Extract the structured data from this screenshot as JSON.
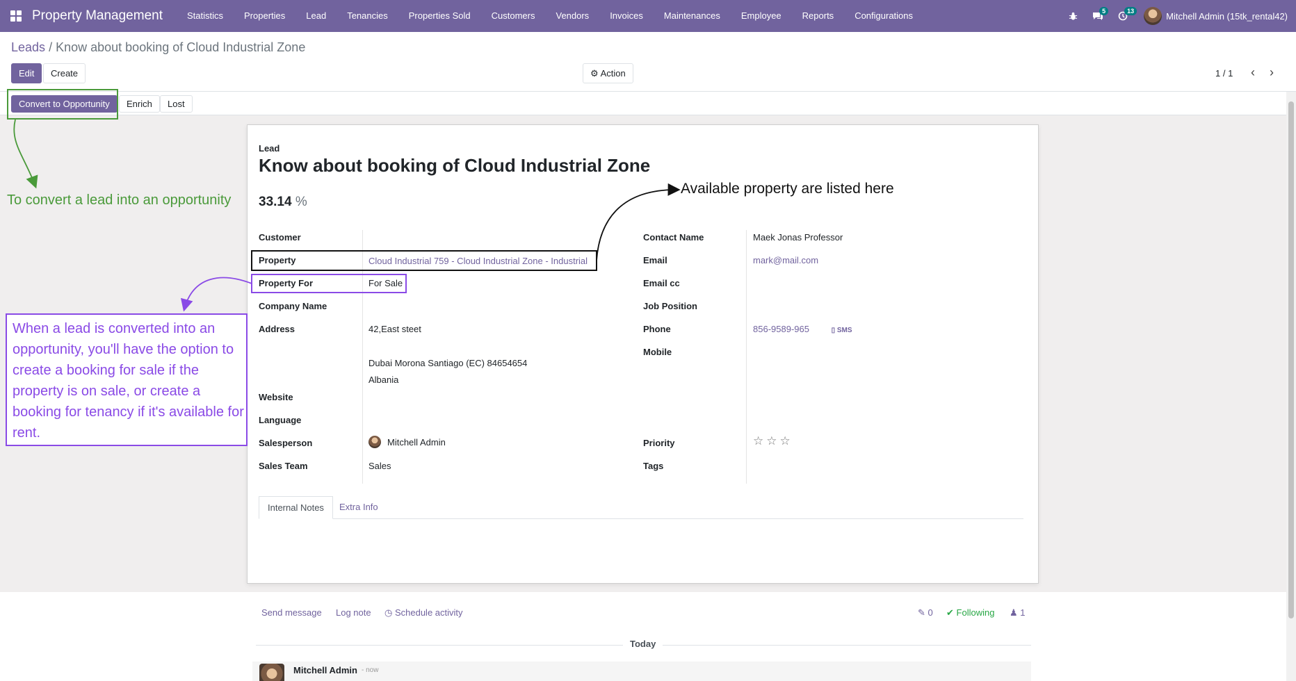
{
  "navbar": {
    "app_title": "Property Management",
    "menu": [
      "Statistics",
      "Properties",
      "Lead",
      "Tenancies",
      "Properties Sold",
      "Customers",
      "Vendors",
      "Invoices",
      "Maintenances",
      "Employee",
      "Reports",
      "Configurations"
    ],
    "messages_count": "5",
    "activities_count": "13",
    "user": "Mitchell Admin (15tk_rental42)"
  },
  "breadcrumb": {
    "parent": "Leads",
    "separator": "/",
    "current": "Know about booking of Cloud Industrial Zone"
  },
  "toolbar": {
    "edit": "Edit",
    "create": "Create",
    "action": "Action",
    "pager": "1 / 1"
  },
  "statusbar": {
    "convert": "Convert to Opportunity",
    "enrich": "Enrich",
    "lost": "Lost"
  },
  "lead": {
    "label": "Lead",
    "title": "Know about booking of Cloud Industrial Zone",
    "probability": "33.14",
    "probability_unit": "%"
  },
  "left_fields": {
    "customer_label": "Customer",
    "property_label": "Property",
    "property_value": "Cloud Industrial 759 - Cloud Industrial Zone - Industrial",
    "property_for_label": "Property For",
    "property_for_value": "For Sale",
    "company_label": "Company Name",
    "address_label": "Address",
    "address_street": "42,East steet",
    "address_city": "Dubai  Morona Santiago (EC)  84654654",
    "address_country": "Albania",
    "website_label": "Website",
    "language_label": "Language",
    "salesperson_label": "Salesperson",
    "salesperson_value": "Mitchell Admin",
    "sales_team_label": "Sales Team",
    "sales_team_value": "Sales"
  },
  "right_fields": {
    "contact_label": "Contact Name",
    "contact_value": "Maek Jonas  Professor",
    "email_label": "Email",
    "email_value": "mark@mail.com",
    "email_cc_label": "Email cc",
    "job_label": "Job Position",
    "phone_label": "Phone",
    "phone_value": "856-9589-965",
    "sms_label": "SMS",
    "mobile_label": "Mobile",
    "priority_label": "Priority",
    "priority_stars": 0,
    "tags_label": "Tags"
  },
  "tabs": [
    "Internal Notes",
    "Extra Info"
  ],
  "chatter": {
    "send_message": "Send message",
    "log_note": "Log note",
    "schedule": "Schedule activity",
    "attachments": "0",
    "following": "Following",
    "followers": "1",
    "today": "Today",
    "author": "Mitchell Admin",
    "time": "- now"
  },
  "annotations": {
    "convert_note": "To convert a lead into an opportunity",
    "property_note": "Available property are listed here",
    "booking_note": "When a lead is converted into an opportunity, you'll have the option to create a booking for sale if the property is on sale, or create a booking for tenancy if it's available for rent."
  },
  "colors": {
    "primary": "#71639e",
    "green_annotation": "#4a9a3a",
    "purple_annotation": "#8a4ae6"
  }
}
